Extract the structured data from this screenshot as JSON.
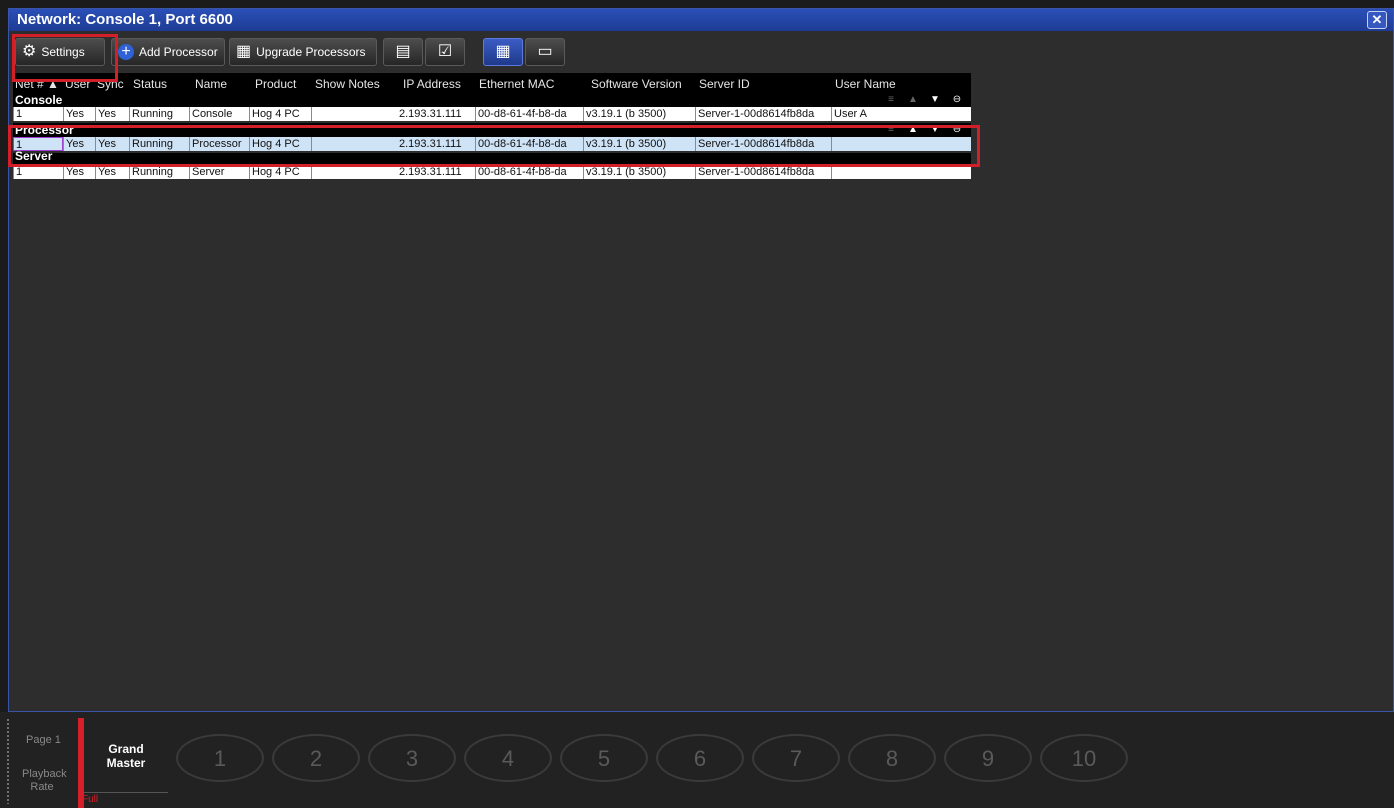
{
  "window": {
    "title": "Network: Console 1, Port 6600",
    "close_icon": "close-icon"
  },
  "toolbar": {
    "settings": "Settings",
    "add_processor": "Add Processor",
    "upgrade_processors": "Upgrade Processors"
  },
  "table": {
    "columns": [
      "Net #",
      "User",
      "Sync",
      "Status",
      "Name",
      "Product",
      "Show Notes",
      "IP Address",
      "Ethernet MAC",
      "Software Version",
      "Server ID",
      "User Name"
    ],
    "header_net": "Net # ▲",
    "header_user": "User",
    "header_sync": "Sync",
    "groups": [
      {
        "label": "Console",
        "row": [
          "1",
          "Yes",
          "Yes",
          "Running",
          "Console",
          "Hog 4 PC",
          "",
          "2.193.31.111",
          "00-d8-61-4f-b8-da",
          "v3.19.1 (b 3500)",
          "Server-1-00d8614fb8da",
          "User A"
        ]
      },
      {
        "label": "Processor",
        "row": [
          "1",
          "Yes",
          "Yes",
          "Running",
          "Processor",
          "Hog 4 PC",
          "",
          "2.193.31.111",
          "00-d8-61-4f-b8-da",
          "v3.19.1 (b 3500)",
          "Server-1-00d8614fb8da",
          ""
        ]
      },
      {
        "label": "Server",
        "row": [
          "1",
          "Yes",
          "Yes",
          "Running",
          "Server",
          "Hog 4 PC",
          "",
          "2.193.31.111",
          "00-d8-61-4f-b8-da",
          "v3.19.1 (b 3500)",
          "Server-1-00d8614fb8da",
          ""
        ]
      }
    ]
  },
  "bottom": {
    "page": "Page 1",
    "playback_rate": "Playback Rate",
    "grand_master": "Grand Master",
    "full": "Full",
    "playbacks": [
      "1",
      "2",
      "3",
      "4",
      "5",
      "6",
      "7",
      "8",
      "9",
      "10"
    ]
  },
  "colors": {
    "title_bar": "#2a4fb8",
    "highlight": "#d21f2a",
    "selected_row": "#cfe3f7"
  }
}
